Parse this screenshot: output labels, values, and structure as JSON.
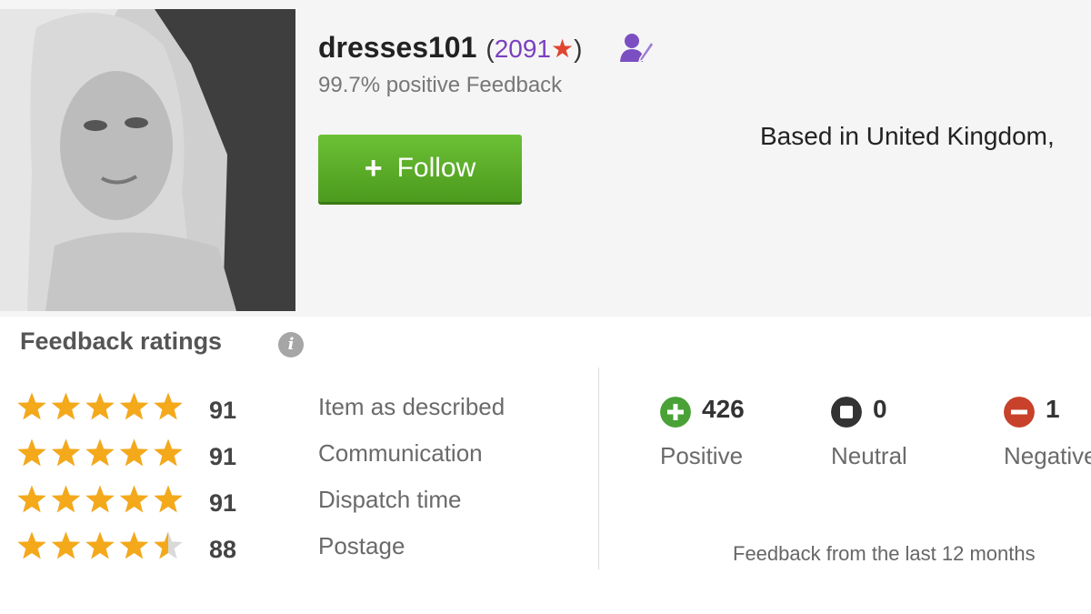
{
  "profile": {
    "username": "dresses101",
    "score_open": "(",
    "score": "2091",
    "score_star": "★",
    "score_close": ")",
    "positive_feedback": "99.7% positive Feedback",
    "seller_icon": "member-badge-icon",
    "follow_icon": "+",
    "follow_label": "Follow",
    "location": "Based in United Kingdom,"
  },
  "ratings": {
    "title": "Feedback ratings",
    "info_icon": "i",
    "star_color": "#f4a91b",
    "items": [
      {
        "label": "Item as described",
        "value": "91",
        "stars": 5
      },
      {
        "label": "Communication",
        "value": "91",
        "stars": 5
      },
      {
        "label": "Dispatch time",
        "value": "91",
        "stars": 5
      },
      {
        "label": "Postage",
        "value": "88",
        "stars": 4.5
      }
    ]
  },
  "counts": {
    "positive": {
      "value": "426",
      "label": "Positive",
      "icon": "plus-circle-icon",
      "color": "#4aa237"
    },
    "neutral": {
      "value": "0",
      "label": "Neutral",
      "icon": "neutral-circle-icon",
      "color": "#333333"
    },
    "negative": {
      "value": "1",
      "label": "Negative",
      "icon": "minus-circle-icon",
      "color": "#c8412b"
    },
    "period": "Feedback from the last 12 months"
  },
  "colors": {
    "follow_green": "#5cae2a",
    "score_purple": "#7b3fbf",
    "score_star": "#e0452f"
  }
}
